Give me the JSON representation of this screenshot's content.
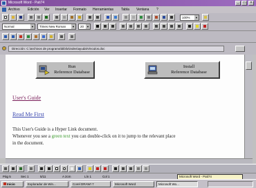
{
  "window": {
    "title": "Microsoft Word - Pati74"
  },
  "menu": [
    "Archivo",
    "Edición",
    "Ver",
    "Insertar",
    "Formato",
    "Herramientas",
    "Tabla",
    "Ventana",
    "?"
  ],
  "format": {
    "style": "Normal",
    "font": "Times New Roman",
    "size": "20"
  },
  "standard": {
    "zoom": "100%"
  },
  "address": {
    "text": "Dirección: C:\\archivos de programa\\biblio\\index\\ayuda\\Vinculos.doc"
  },
  "document": {
    "button_run": {
      "line1": "Run",
      "line2": "Reference Database"
    },
    "button_install": {
      "line1": "Install",
      "line2": "Reference Database"
    },
    "link_guide": "User's Guide",
    "link_readme": "Read Me First",
    "para_line1": "This User's Guide is a Hyper Link document.",
    "para_line2_a": "Whenever you see a ",
    "para_line2_green": "green text",
    "para_line2_b": " you can double-click on it to jump to the relevant place",
    "para_line3": "in the document."
  },
  "status": {
    "page": "Pág 5",
    "section": "Sec 1",
    "pos": "5/11",
    "at": "A 2cm",
    "line": "Lín 1",
    "col": "Col 1"
  },
  "tooltip": "Microsoft Word - Pati74",
  "taskbar": {
    "start": "Inicio",
    "tasks": [
      "Explorador de Win...",
      "Corel DRAW! 7",
      "Microsoft Word",
      "Microsoft Wo..."
    ]
  },
  "colors": {
    "titlebar": "#7f4a9a",
    "link": "#7a1e5a",
    "link_visited": "#3a48b0",
    "green_text": "#3c9a2e"
  }
}
